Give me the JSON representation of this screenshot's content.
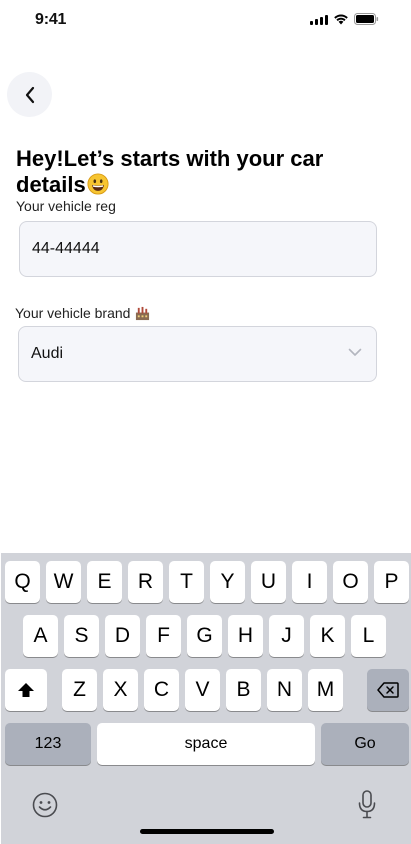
{
  "status_bar": {
    "time": "9:41"
  },
  "header": {
    "title": "Hey!Let’s starts with your car details",
    "title_emoji": "grinning-face-icon"
  },
  "form": {
    "reg_label": "Your vehicle reg",
    "reg_value": "44-44444",
    "brand_label": "Your vehicle brand",
    "brand_label_emoji": "factory-icon",
    "brand_value": "Audi"
  },
  "keyboard": {
    "row1": [
      "Q",
      "W",
      "E",
      "R",
      "T",
      "Y",
      "U",
      "I",
      "O",
      "P"
    ],
    "row2": [
      "A",
      "S",
      "D",
      "F",
      "G",
      "H",
      "J",
      "K",
      "L"
    ],
    "row3": [
      "Z",
      "X",
      "C",
      "V",
      "B",
      "N",
      "M"
    ],
    "numbers_label": "123",
    "space_label": "space",
    "go_label": "Go",
    "icons": [
      "shift-icon",
      "backspace-icon",
      "emoji-icon",
      "microphone-icon"
    ]
  },
  "colors": {
    "field_background": "#f5f6fa",
    "field_border": "#d3d5dc",
    "keyboard_background": "#d1d3d9",
    "key_dark": "#abb0bb"
  }
}
